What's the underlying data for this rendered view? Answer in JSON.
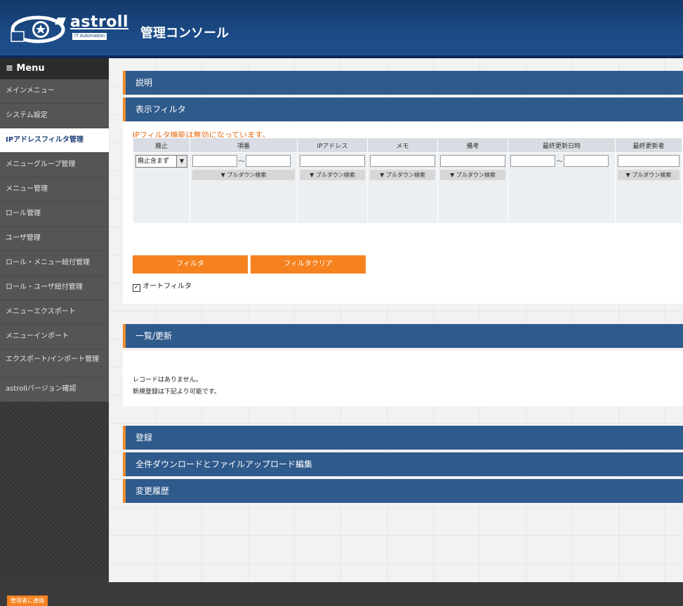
{
  "header": {
    "logo_text": "astroll",
    "logo_sub": "IT Automation",
    "title": "管理コンソール"
  },
  "sidebar": {
    "menu_label": "≡ Menu",
    "items": [
      {
        "label": "メインメニュー"
      },
      {
        "label": "システム設定"
      },
      {
        "label": "IPアドレスフィルタ管理",
        "active": true
      },
      {
        "label": "メニューグループ管理"
      },
      {
        "label": "メニュー管理"
      },
      {
        "label": "ロール管理"
      },
      {
        "label": "ユーザ管理"
      },
      {
        "label": "ロール・メニュー紐付管理"
      },
      {
        "label": "ロール・ユーザ紐付管理"
      },
      {
        "label": "メニューエクスポート"
      },
      {
        "label": "メニューインポート"
      },
      {
        "label": "エクスポート/インポート管理"
      },
      {
        "label": "astrollバージョン確認"
      }
    ]
  },
  "sections": {
    "description": "説明",
    "filter": "表示フィルタ",
    "list": "一覧/更新",
    "register": "登録",
    "bulk": "全件ダウンロードとファイルアップロード編集",
    "history": "変更履歴"
  },
  "filter_panel": {
    "notice": "IPフィルタ機能は無効になっています。",
    "columns": [
      "廃止",
      "項番",
      "IPアドレス",
      "メモ",
      "備考",
      "最終更新日時",
      "最終更新者"
    ],
    "discard_select": "廃止含まず",
    "range_sep": "～",
    "pulldown_label": "▼ プルダウン検索",
    "filter_button": "フィルタ",
    "clear_button": "フィルタクリア",
    "auto_filter_label": "オートフィルタ",
    "auto_filter_checked": true
  },
  "list_panel": {
    "no_records": "レコードはありません。",
    "hint": "新規登録は下記より可能です。"
  },
  "footer": {
    "contact_button": "管理者に連絡"
  },
  "colors": {
    "header": "#1b4a85",
    "bar": "#2f5a8c",
    "accent": "#f5821f",
    "notice": "#e56a12"
  }
}
